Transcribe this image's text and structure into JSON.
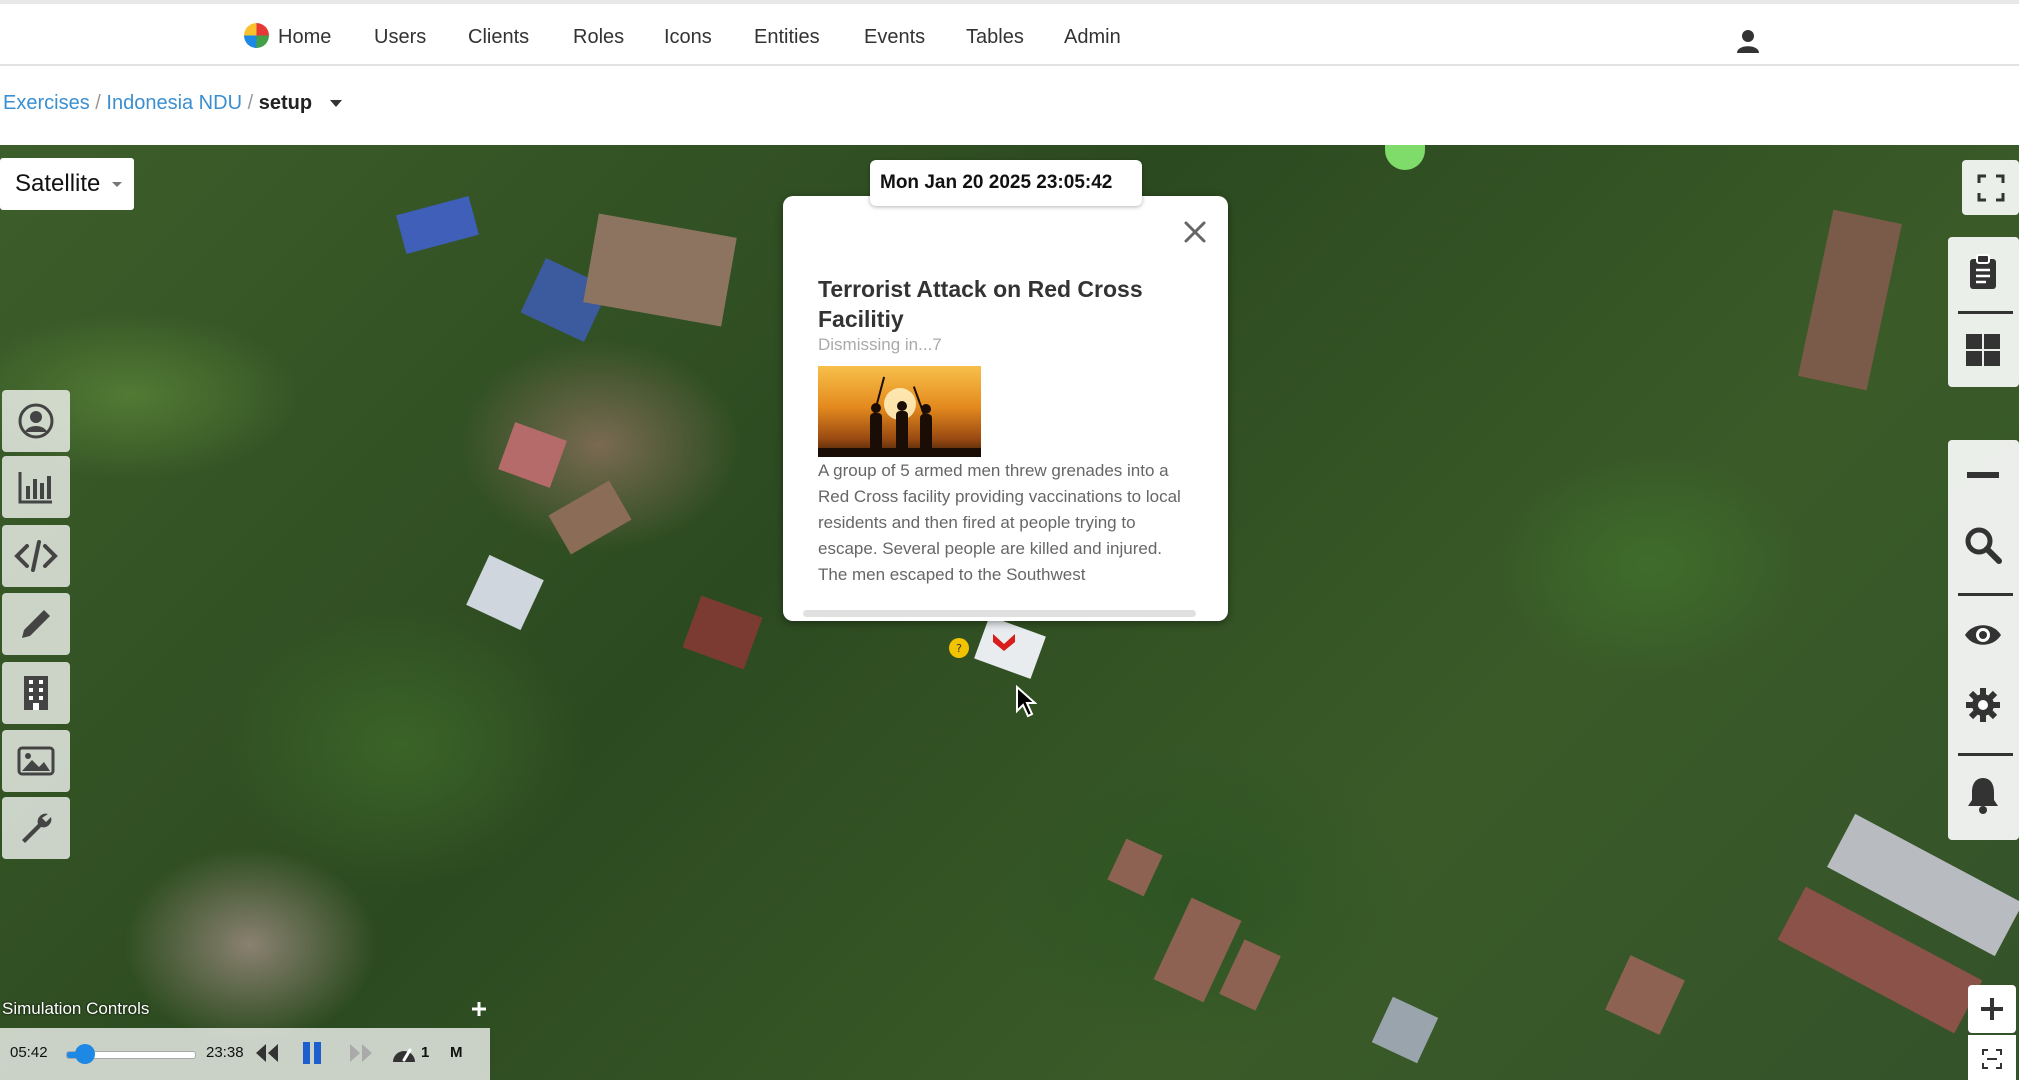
{
  "nav": {
    "home": "Home",
    "items": [
      "Users",
      "Clients",
      "Roles",
      "Icons",
      "Entities",
      "Events",
      "Tables",
      "Admin"
    ]
  },
  "breadcrumb": {
    "exercises": "Exercises",
    "sep1": "/",
    "exercise": "Indonesia NDU",
    "sep2": "/",
    "current": "setup"
  },
  "map": {
    "layer_button": "Satellite",
    "timestamp": "Mon Jan 20 2025 23:05:42"
  },
  "popup": {
    "title": "Terrorist Attack on Red Cross Facilitiy",
    "dismiss": "Dismissing in...7",
    "body": "A group of 5 armed men threw grenades into a Red Cross facility providing vaccinations to local residents and then fired at people trying to escape. Several people are killed and injured. The men escaped to the Southwest"
  },
  "left_toolbar": [
    "user-circle-icon",
    "bar-chart-icon",
    "code-icon",
    "pencil-icon",
    "building-icon",
    "image-icon",
    "wrench-icon"
  ],
  "right_toolbar": [
    "clipboard-icon",
    "grid-icon",
    "minus-icon",
    "search-icon",
    "eye-icon",
    "gear-icon",
    "bell-icon"
  ],
  "simulation": {
    "label": "Simulation Controls",
    "start_time": "05:42",
    "end_time": "23:38",
    "progress": 0.15,
    "speed": "1",
    "mode": "M"
  },
  "colors": {
    "link": "#3a8fd0",
    "accent": "#1e88e5",
    "marker_red": "#d81b1b",
    "marker_yellow": "#f2c300"
  }
}
